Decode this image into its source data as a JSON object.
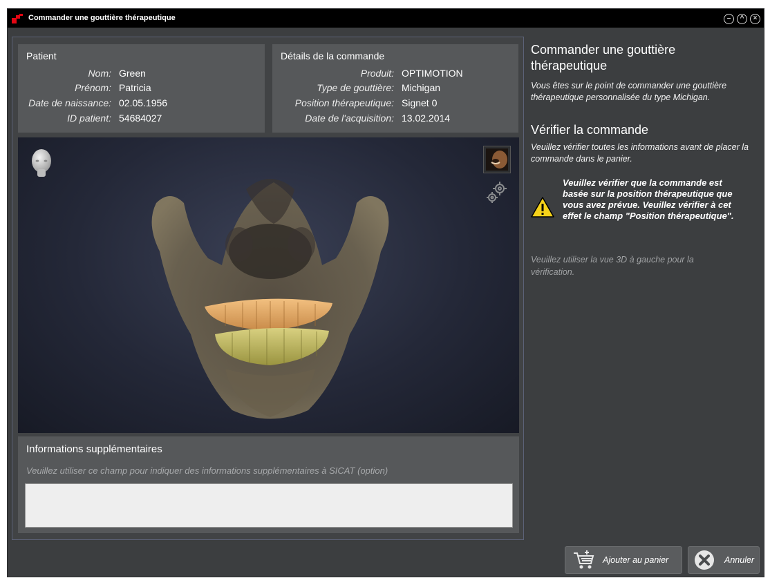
{
  "window": {
    "title": "Commander une gouttière thérapeutique"
  },
  "patient": {
    "heading": "Patient",
    "rows": [
      {
        "label": "Nom:",
        "value": "Green"
      },
      {
        "label": "Prénom:",
        "value": "Patricia"
      },
      {
        "label": "Date de naissance:",
        "value": "02.05.1956"
      },
      {
        "label": "ID patient:",
        "value": "54684027"
      }
    ]
  },
  "order": {
    "heading": "Détails de la commande",
    "rows": [
      {
        "label": "Produit:",
        "value": "OPTIMOTION"
      },
      {
        "label": "Type de gouttière:",
        "value": "Michigan"
      },
      {
        "label": "Position thérapeutique:",
        "value": "Signet 0"
      },
      {
        "label": "Date de l'acquisition:",
        "value": "13.02.2014"
      }
    ]
  },
  "viewport": {
    "icons": [
      "head-orientation-icon",
      "photo-thumbnail-icon",
      "gear-icon"
    ]
  },
  "extra": {
    "heading": "Informations supplémentaires",
    "hint": "Veuillez utiliser ce champ pour indiquer des informations supplémentaires à SICAT (option)",
    "value": ""
  },
  "help": {
    "title": "Commander une gouttière thérapeutique",
    "intro": "Vous êtes sur le point de commander une gouttière thérapeutique personnalisée du type Michigan.",
    "verify_title": "Vérifier la commande",
    "verify_text": "Veuillez vérifier toutes les informations avant de placer la commande dans le panier.",
    "warning": "Veuillez vérifier que la commande est basée sur la position thérapeutique que vous avez prévue. Veuillez vérifier à cet effet le champ \"Position thérapeutique\".",
    "hint": "Veuillez utiliser la vue 3D à gauche pour la vérification."
  },
  "buttons": {
    "add_to_cart": "Ajouter au panier",
    "cancel": "Annuler"
  },
  "colors": {
    "background": "#3c3e40",
    "panel": "#56585a",
    "accent": "#e30613",
    "teeth_upper": "#e8b070",
    "teeth_lower": "#c9c070"
  }
}
